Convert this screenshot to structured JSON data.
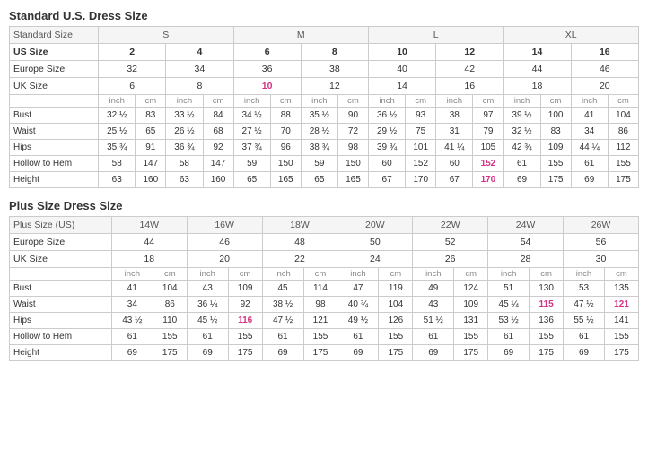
{
  "standard": {
    "title": "Standard U.S. Dress Size",
    "sizeGroupRow": [
      "Standard Size",
      "S",
      "",
      "",
      "",
      "M",
      "",
      "",
      "",
      "L",
      "",
      "",
      "",
      "XL",
      "",
      "",
      ""
    ],
    "usRow": [
      "US Size",
      "2",
      "4",
      "6",
      "8",
      "10",
      "12",
      "14",
      "16"
    ],
    "europeRow": [
      "Europe Size",
      "32",
      "34",
      "36",
      "38",
      "40",
      "42",
      "44",
      "46"
    ],
    "ukRow": [
      "UK Size",
      "6",
      "8",
      "10",
      "12",
      "14",
      "16",
      "18",
      "20"
    ],
    "colLabels": [
      "",
      "inch",
      "cm",
      "inch",
      "cm",
      "inch",
      "cm",
      "inch",
      "cm",
      "inch",
      "cm",
      "inch",
      "cm",
      "inch",
      "cm",
      "inch",
      "cm"
    ],
    "bust": [
      "Bust",
      "32 ½",
      "83",
      "33 ½",
      "84",
      "34 ½",
      "88",
      "35 ½",
      "90",
      "36 ½",
      "93",
      "38",
      "97",
      "39 ½",
      "100",
      "41",
      "104"
    ],
    "waist": [
      "Waist",
      "25 ½",
      "65",
      "26 ½",
      "68",
      "27 ½",
      "70",
      "28 ½",
      "72",
      "29 ½",
      "75",
      "31",
      "79",
      "32 ½",
      "83",
      "34",
      "86"
    ],
    "hips": [
      "Hips",
      "35 ¾",
      "91",
      "36 ¾",
      "92",
      "37 ¾",
      "96",
      "38 ¾",
      "98",
      "39 ¾",
      "101",
      "41 ¼",
      "105",
      "42 ¾",
      "109",
      "44 ¼",
      "112"
    ],
    "hollow": [
      "Hollow to Hem",
      "58",
      "147",
      "58",
      "147",
      "59",
      "150",
      "59",
      "150",
      "60",
      "152",
      "60",
      "152",
      "61",
      "155",
      "61",
      "155"
    ],
    "height": [
      "Height",
      "63",
      "160",
      "63",
      "160",
      "65",
      "165",
      "65",
      "165",
      "67",
      "170",
      "67",
      "170",
      "69",
      "175",
      "69",
      "175"
    ]
  },
  "plus": {
    "title": "Plus Size Dress Size",
    "sizeGroupRow": [
      "Plus Size (US)",
      "14W",
      "",
      "16W",
      "",
      "18W",
      "",
      "20W",
      "",
      "22W",
      "",
      "24W",
      "",
      "26W",
      ""
    ],
    "europeRow": [
      "Europe Size",
      "44",
      "",
      "46",
      "",
      "48",
      "",
      "50",
      "",
      "52",
      "",
      "54",
      "",
      "56",
      ""
    ],
    "ukRow": [
      "UK Size",
      "18",
      "",
      "20",
      "",
      "22",
      "",
      "24",
      "",
      "26",
      "",
      "28",
      "",
      "30",
      ""
    ],
    "colLabels": [
      "",
      "inch",
      "cm",
      "inch",
      "cm",
      "inch",
      "cm",
      "inch",
      "cm",
      "inch",
      "cm",
      "inch",
      "cm",
      "inch",
      "cm"
    ],
    "bust": [
      "Bust",
      "41",
      "104",
      "43",
      "109",
      "45",
      "114",
      "47",
      "119",
      "49",
      "124",
      "51",
      "130",
      "53",
      "135"
    ],
    "waist": [
      "Waist",
      "34",
      "86",
      "36 ¼",
      "92",
      "38 ½",
      "98",
      "40 ¾",
      "104",
      "43",
      "109",
      "45 ¼",
      "115",
      "47 ½",
      "121"
    ],
    "hips": [
      "Hips",
      "43 ½",
      "110",
      "45 ½",
      "116",
      "47 ½",
      "121",
      "49 ½",
      "126",
      "51 ½",
      "131",
      "53 ½",
      "136",
      "55 ½",
      "141"
    ],
    "hollow": [
      "Hollow to Hem",
      "61",
      "155",
      "61",
      "155",
      "61",
      "155",
      "61",
      "155",
      "61",
      "155",
      "61",
      "155",
      "61",
      "155"
    ],
    "height": [
      "Height",
      "69",
      "175",
      "69",
      "175",
      "69",
      "175",
      "69",
      "175",
      "69",
      "175",
      "69",
      "175",
      "69",
      "175"
    ]
  }
}
